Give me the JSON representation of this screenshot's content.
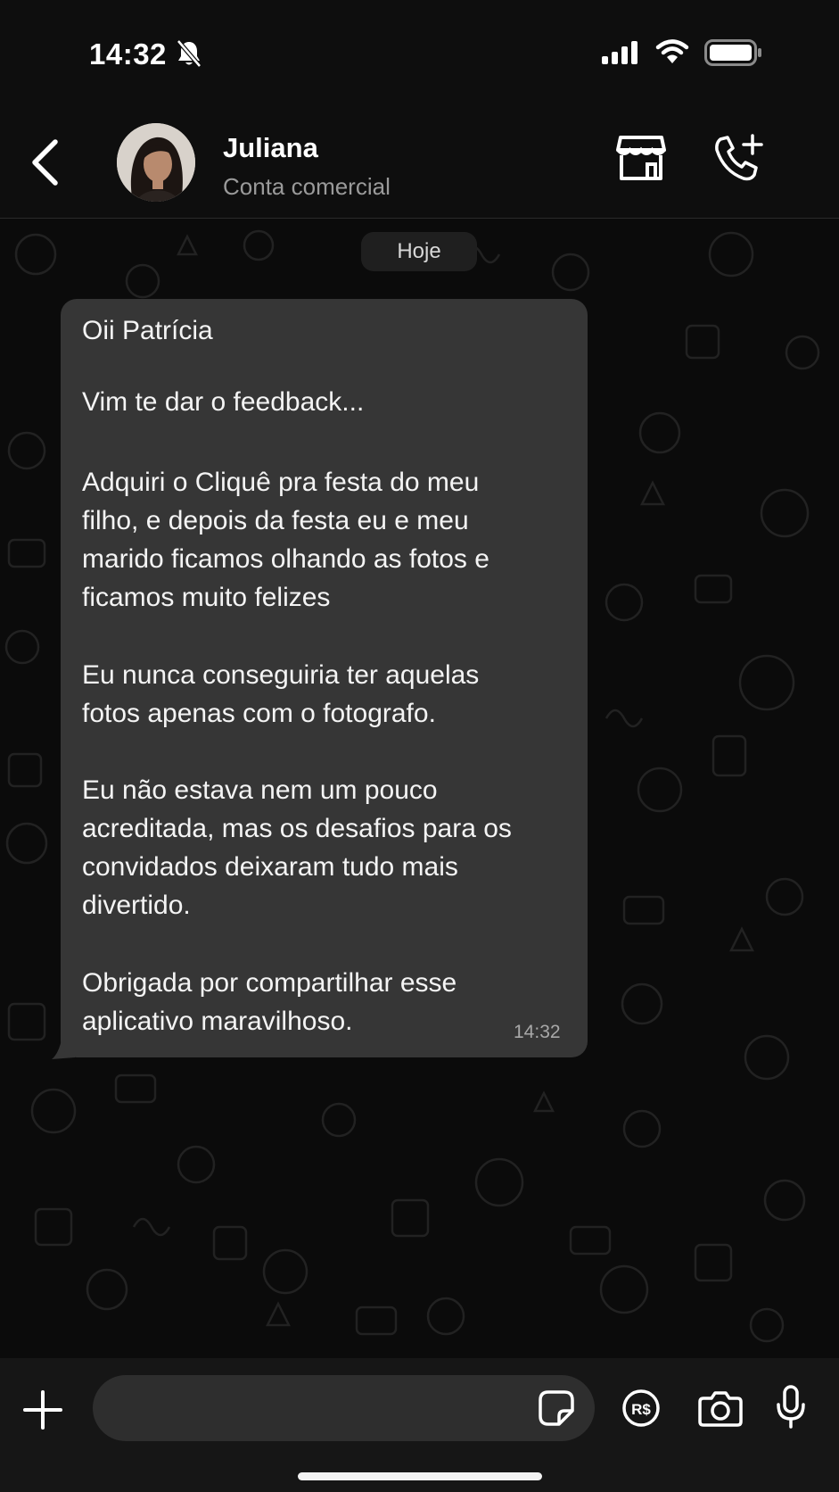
{
  "status": {
    "time": "14:32"
  },
  "header": {
    "contact_name": "Juliana",
    "contact_subtitle": "Conta comercial"
  },
  "chat": {
    "date_chip": "Hoje",
    "message": {
      "lines": [
        "Oii Patrícia",
        "",
        "Vim te dar o feedback...",
        "",
        "Adquiri o Cliquê pra festa do meu",
        "filho, e depois da festa eu e meu",
        "marido ficamos olhando as fotos e",
        "ficamos muito felizes",
        "",
        "Eu nunca conseguiria ter aquelas",
        "fotos apenas com o fotografo.",
        "",
        "Eu não estava nem um pouco",
        "acreditada, mas os desafios para os",
        "convidados deixaram tudo mais",
        "divertido.",
        "",
        "Obrigada por compartilhar esse",
        "aplicativo maravilhoso."
      ],
      "time": "14:32"
    }
  },
  "composer": {
    "placeholder": ""
  },
  "icons": {
    "status": [
      "bell-off-icon",
      "signal-icon",
      "wifi-icon",
      "battery-icon"
    ],
    "header": [
      "chevron-left-icon",
      "store-icon",
      "phone-plus-icon"
    ],
    "composer": [
      "plus-icon",
      "sticker-icon",
      "currency-icon",
      "camera-icon",
      "microphone-icon"
    ]
  },
  "colors": {
    "background": "#0b0b0b",
    "bubble": "#363636",
    "bar": "#161616",
    "subtitle": "#9a9a9a"
  }
}
